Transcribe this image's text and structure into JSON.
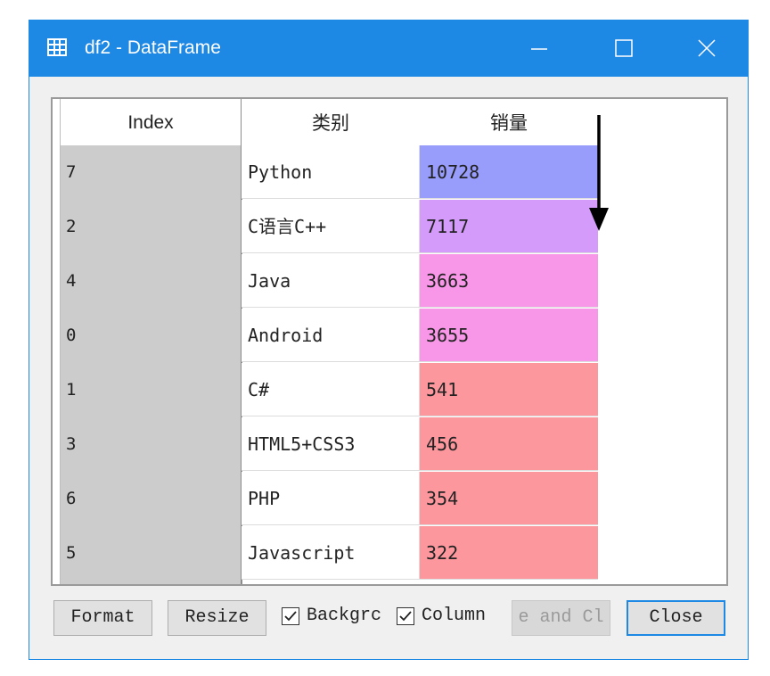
{
  "window": {
    "title": "df2 - DataFrame",
    "icon": "table-icon",
    "titlebar_color": "#1e88e5"
  },
  "table": {
    "headers": {
      "index": "Index",
      "category": "类别",
      "sales": "销量"
    },
    "rows": [
      {
        "index": "7",
        "category": "Python",
        "sales": "10728",
        "color": "#989cfb"
      },
      {
        "index": "2",
        "category": "C语言C++",
        "sales": "7117",
        "color": "#d59bfb"
      },
      {
        "index": "4",
        "category": "Java",
        "sales": "3663",
        "color": "#f897e7"
      },
      {
        "index": "0",
        "category": "Android",
        "sales": "3655",
        "color": "#f897e7"
      },
      {
        "index": "1",
        "category": "C#",
        "sales": "541",
        "color": "#fc979e"
      },
      {
        "index": "3",
        "category": "HTML5+CSS3",
        "sales": "456",
        "color": "#fc979e"
      },
      {
        "index": "6",
        "category": "PHP",
        "sales": "354",
        "color": "#fc979e"
      },
      {
        "index": "5",
        "category": "Javascript",
        "sales": "322",
        "color": "#fc979e"
      }
    ]
  },
  "annotation": {
    "icon": "sort-down-arrow-icon"
  },
  "buttons": {
    "format": "Format",
    "resize": "Resize",
    "save_close": "e and Cl",
    "close": "Close"
  },
  "checkboxes": {
    "background": {
      "label": "Backgrc",
      "checked": true
    },
    "column": {
      "label": "Column",
      "checked": true
    }
  }
}
